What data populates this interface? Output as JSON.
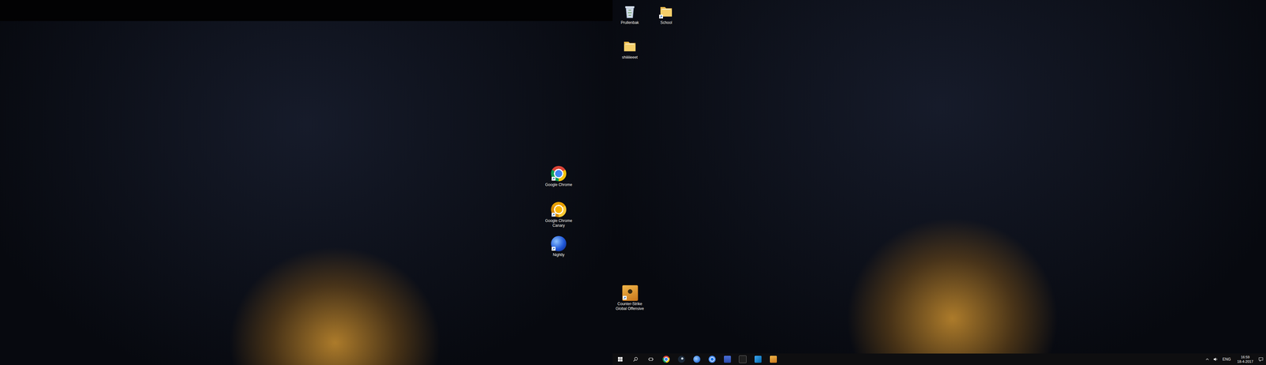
{
  "left_monitor": {
    "icons": [
      {
        "label": "Google Chrome",
        "kind": "chrome",
        "shortcut": true
      },
      {
        "label": "Google Chrome Canary",
        "kind": "canary",
        "shortcut": true
      },
      {
        "label": "Nightly",
        "kind": "nightly",
        "shortcut": true
      }
    ]
  },
  "right_monitor": {
    "icons": [
      {
        "label": "Prullenbak",
        "kind": "recycle-bin",
        "shortcut": false
      },
      {
        "label": "School",
        "kind": "folder",
        "shortcut": true
      },
      {
        "label": "shiiiiieeet",
        "kind": "folder",
        "shortcut": false
      },
      {
        "label": "Counter-Strike Global Offensive",
        "kind": "csgo",
        "shortcut": true
      }
    ]
  },
  "taskbar": {
    "apps": [
      {
        "kind": "start"
      },
      {
        "kind": "search"
      },
      {
        "kind": "task-view"
      },
      {
        "kind": "chrome"
      },
      {
        "kind": "steam"
      },
      {
        "kind": "thunderbird"
      },
      {
        "kind": "chrome-blue"
      },
      {
        "kind": "explorer"
      },
      {
        "kind": "terminal"
      },
      {
        "kind": "vscode"
      },
      {
        "kind": "csgo"
      }
    ],
    "tray": {
      "language": "ENG",
      "time": "16:59",
      "date": "18-4-2017"
    }
  }
}
